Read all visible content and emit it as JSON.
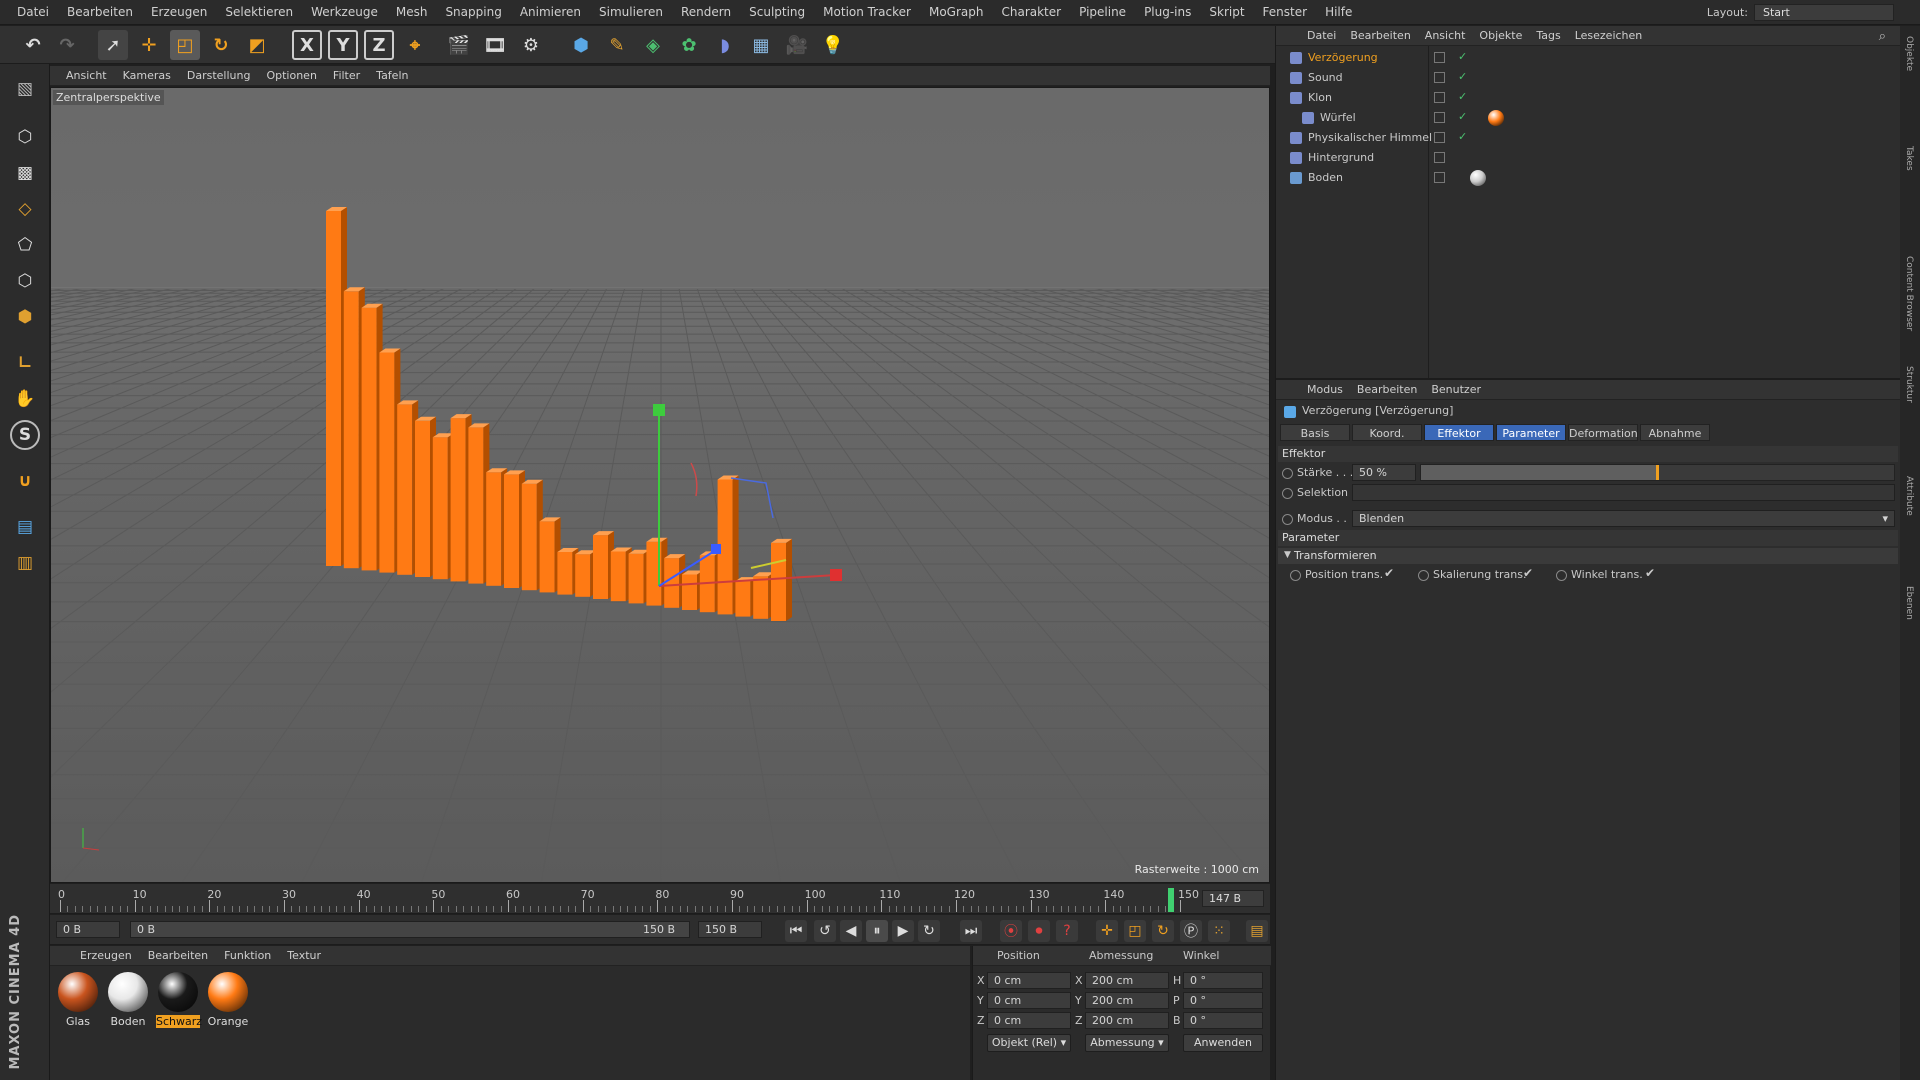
{
  "menu": {
    "items": [
      "Datei",
      "Bearbeiten",
      "Erzeugen",
      "Selektieren",
      "Werkzeuge",
      "Mesh",
      "Snapping",
      "Animieren",
      "Simulieren",
      "Rendern",
      "Sculpting",
      "Motion Tracker",
      "MoGraph",
      "Charakter",
      "Pipeline",
      "Plug-ins",
      "Skript",
      "Fenster",
      "Hilfe"
    ],
    "layout_label": "Layout:",
    "layout_value": "Start"
  },
  "toolbar": {
    "x": "X",
    "y": "Y",
    "z": "Z"
  },
  "lefttools": {
    "s_label": "S"
  },
  "viewport": {
    "menu": [
      "Ansicht",
      "Kameras",
      "Darstellung",
      "Optionen",
      "Filter",
      "Tafeln"
    ],
    "label": "Zentralperspektive",
    "raster": "Rasterweite : 1000 cm",
    "bar_color": "#ff7a14",
    "bar_heights": [
      1.0,
      0.78,
      0.74,
      0.62,
      0.48,
      0.44,
      0.4,
      0.46,
      0.44,
      0.32,
      0.32,
      0.3,
      0.2,
      0.12,
      0.12,
      0.18,
      0.14,
      0.14,
      0.18,
      0.14,
      0.1,
      0.16,
      0.38,
      0.1,
      0.12,
      0.22
    ]
  },
  "timeline": {
    "labels": [
      "0",
      "10",
      "20",
      "30",
      "40",
      "50",
      "60",
      "70",
      "80",
      "90",
      "100",
      "110",
      "120",
      "130",
      "140",
      "150"
    ],
    "current_frame": "147 B"
  },
  "transport": {
    "start": "0 B",
    "range_start": "0 B",
    "range_end": "150 B",
    "end": "150 B"
  },
  "materials": {
    "menu": [
      "Erzeugen",
      "Bearbeiten",
      "Funktion",
      "Textur"
    ],
    "items": [
      {
        "name": "Glas",
        "color": "#c9541e"
      },
      {
        "name": "Boden",
        "color": "#e8e8e8"
      },
      {
        "name": "Schwarz",
        "color": "#1a1a1a"
      },
      {
        "name": "Orange",
        "color": "#ff7a14"
      }
    ],
    "logo": "MAXON CINEMA 4D"
  },
  "coords": {
    "headers": [
      "Position",
      "Abmessung",
      "Winkel"
    ],
    "rows": [
      {
        "axis": "X",
        "pos": "0 cm",
        "size_axis": "X",
        "size": "200 cm",
        "rot_axis": "H",
        "rot": "0 °"
      },
      {
        "axis": "Y",
        "pos": "0 cm",
        "size_axis": "Y",
        "size": "200 cm",
        "rot_axis": "P",
        "rot": "0 °"
      },
      {
        "axis": "Z",
        "pos": "0 cm",
        "size_axis": "Z",
        "size": "200 cm",
        "rot_axis": "B",
        "rot": "0 °"
      }
    ],
    "mode": "Objekt (Rel)",
    "size_mode": "Abmessung",
    "apply": "Anwenden"
  },
  "objects": {
    "menu": [
      "Datei",
      "Bearbeiten",
      "Ansicht",
      "Objekte",
      "Tags",
      "Lesezeichen"
    ],
    "items": [
      {
        "name": "Verzögerung",
        "color": "#f0a020"
      },
      {
        "name": "Sound",
        "color": "#c9c9c9"
      },
      {
        "name": "Klon",
        "color": "#c9c9c9"
      },
      {
        "name": "Würfel",
        "color": "#c9c9c9"
      },
      {
        "name": "Physikalischer Himmel",
        "color": "#c9c9c9"
      },
      {
        "name": "Hintergrund",
        "color": "#c9c9c9"
      },
      {
        "name": "Boden",
        "color": "#c9c9c9"
      }
    ]
  },
  "attributes": {
    "menu": [
      "Modus",
      "Bearbeiten",
      "Benutzer"
    ],
    "title": "Verzögerung [Verzögerung]",
    "tabs": [
      "Basis",
      "Koord.",
      "Effektor",
      "Parameter",
      "Deformation",
      "Abnahme"
    ],
    "section_effektor": "Effektor",
    "strength_label": "Stärke . . .",
    "strength_value": "50 %",
    "strength_fraction": 0.5,
    "selection_label": "Selektion",
    "mode_label": "Modus . .",
    "mode_value": "Blenden",
    "section_parameter": "Parameter",
    "group_transform": "Transformieren",
    "pos_trans": "Position trans.",
    "scale_trans": "Skalierung trans.",
    "angle_trans": "Winkel trans."
  },
  "sidetabs": [
    "Objekte",
    "Takes",
    "Content Browser",
    "Struktur",
    "Attribute",
    "Ebenen"
  ]
}
